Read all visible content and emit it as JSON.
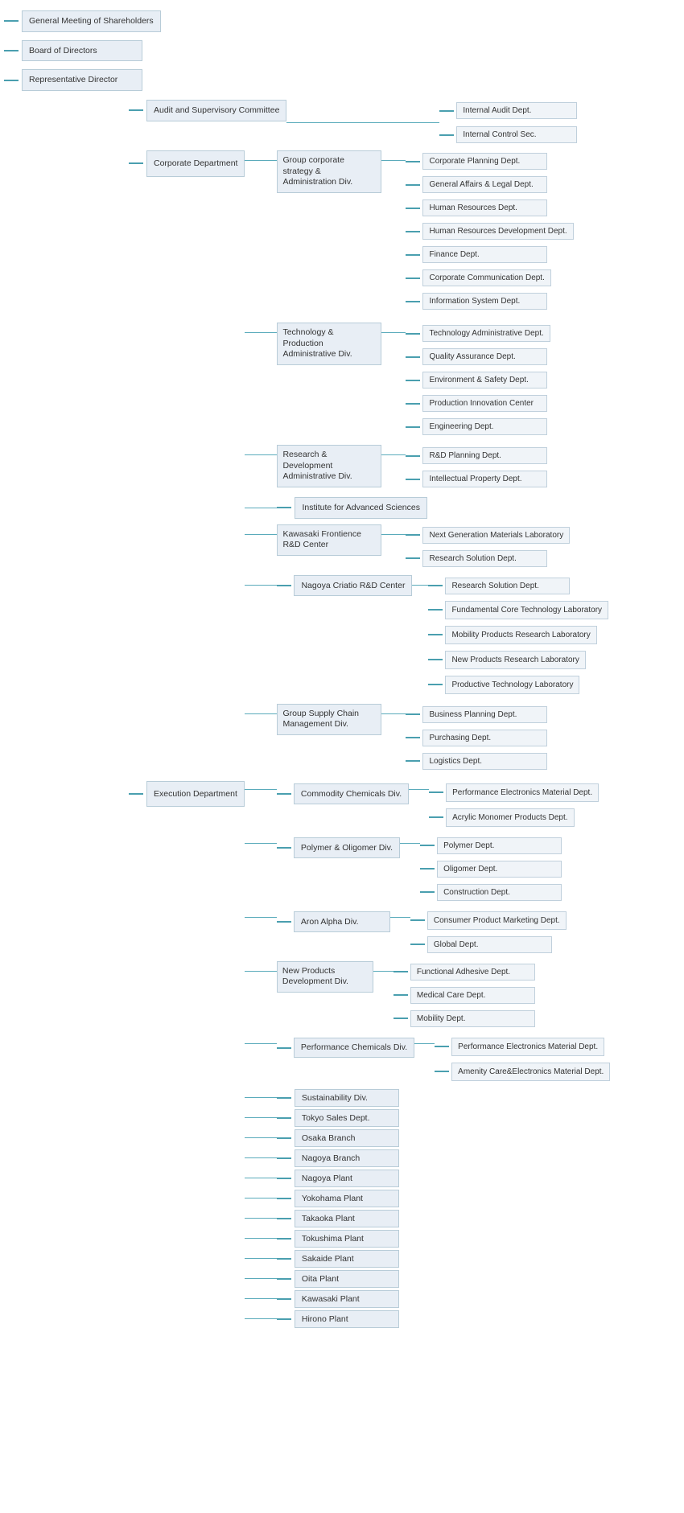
{
  "chart": {
    "top_nodes": [
      {
        "id": "general-meeting",
        "label": "General Meeting of Shareholders"
      },
      {
        "id": "board",
        "label": "Board of Directors"
      },
      {
        "id": "rep-director",
        "label": "Representative Director"
      }
    ],
    "audit_supervisory": "Audit and Supervisory Committee",
    "internal_audit": "Internal Audit Dept.",
    "internal_control": "Internal Control Sec.",
    "corporate_dept": {
      "label": "Corporate Department",
      "divisions": [
        {
          "label": "Group corporate strategy & Administration Div.",
          "depts": [
            "Corporate Planning Dept.",
            "General Affairs & Legal Dept.",
            "Human Resources Dept.",
            "Human Resources Development Dept.",
            "Finance Dept.",
            "Corporate Communication Dept.",
            "Information System Dept."
          ]
        },
        {
          "label": "Technology & Production Administrative Div.",
          "depts": [
            "Technology Administrative Dept.",
            "Quality Assurance Dept.",
            "Environment & Safety Dept.",
            "Production Innovation Center",
            "Engineering Dept."
          ]
        },
        {
          "label": "Research & Development Administrative Div.",
          "depts": [
            "R&D Planning Dept.",
            "Intellectual Property Dept."
          ]
        },
        {
          "label": "Institute for Advanced Sciences",
          "depts": []
        },
        {
          "label": "Kawasaki Frontience R&D Center",
          "depts": [
            "Next Generation Materials Laboratory",
            "Research Solution Dept."
          ]
        },
        {
          "label": "Nagoya Criatio R&D Center",
          "depts": [
            "Research Solution Dept.",
            "Fundamental Core Technology Laboratory",
            "Mobility Products Research Laboratory",
            "New Products Research Laboratory",
            "Productive Technology Laboratory"
          ]
        },
        {
          "label": "Group Supply Chain Management Div.",
          "depts": [
            "Business Planning Dept.",
            "Purchasing Dept.",
            "Logistics Dept."
          ]
        }
      ]
    },
    "execution_dept": {
      "label": "Execution Department",
      "divisions": [
        {
          "label": "Commodity Chemicals Div.",
          "depts": [
            "Performance Electronics Material Dept.",
            "Acrylic Monomer Products Dept."
          ]
        },
        {
          "label": "Polymer & Oligomer Div.",
          "depts": [
            "Polymer Dept.",
            "Oligomer Dept.",
            "Construction Dept."
          ]
        },
        {
          "label": "Aron Alpha Div.",
          "depts": [
            "Consumer Product Marketing Dept.",
            "Global Dept."
          ]
        },
        {
          "label": "New Products Development Div.",
          "depts": [
            "Functional Adhesive Dept.",
            "Medical Care Dept.",
            "Mobility Dept."
          ]
        },
        {
          "label": "Performance Chemicals Div.",
          "depts": [
            "Performance Electronics Material Dept.",
            "Amenity Care&Electronics Material Dept."
          ]
        },
        {
          "label": "Sustainability Div.",
          "depts": []
        },
        {
          "label": "Tokyo Sales Dept.",
          "depts": []
        },
        {
          "label": "Osaka Branch",
          "depts": []
        },
        {
          "label": "Nagoya Branch",
          "depts": []
        },
        {
          "label": "Nagoya Plant",
          "depts": []
        },
        {
          "label": "Yokohama Plant",
          "depts": []
        },
        {
          "label": "Takaoka Plant",
          "depts": []
        },
        {
          "label": "Tokushima Plant",
          "depts": []
        },
        {
          "label": "Sakaide Plant",
          "depts": []
        },
        {
          "label": "Oita Plant",
          "depts": []
        },
        {
          "label": "Kawasaki Plant",
          "depts": []
        },
        {
          "label": "Hirono Plant",
          "depts": []
        }
      ]
    }
  }
}
